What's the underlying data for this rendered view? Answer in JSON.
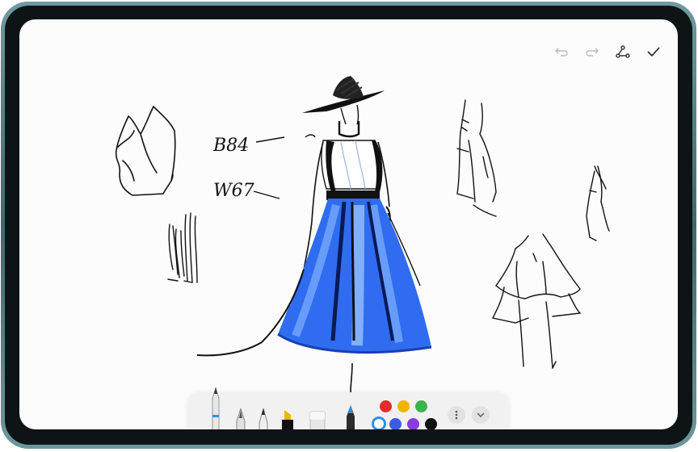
{
  "toolbar_top": {
    "undo_icon": "undo-icon",
    "redo_icon": "redo-icon",
    "share_icon": "share-icon",
    "done_icon": "checkmark-icon"
  },
  "sketch": {
    "annotations": [
      "B84",
      "W67"
    ],
    "dress_color": "#2f6cf0"
  },
  "pen_toolbar": {
    "tools": [
      "pencil",
      "fountain-pen",
      "fine-liner",
      "highlighter",
      "eraser",
      "marker"
    ],
    "selected_tool": "marker",
    "colors": [
      "#e52b2b",
      "#f0b400",
      "#3bb34a",
      "#2f8fe8",
      "#3a5ce0",
      "#8a3be0",
      "#111111"
    ],
    "selected_color": "#2f8fe8",
    "more_icon": "more-vertical-icon",
    "collapse_icon": "chevron-down-icon"
  }
}
